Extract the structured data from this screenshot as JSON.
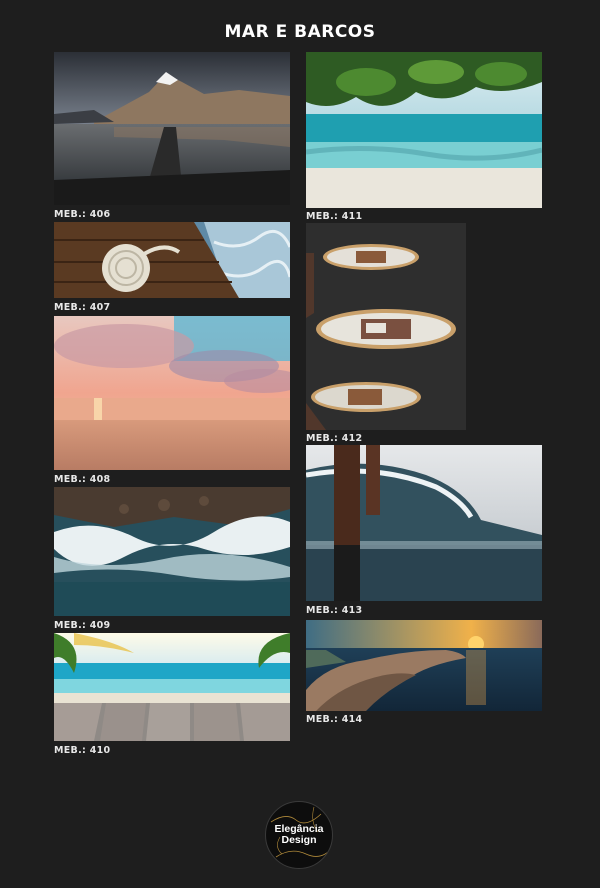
{
  "header": {
    "title": "MAR E BARCOS"
  },
  "items": [
    {
      "code": "MEB.: 406",
      "subject": "mountain lake with wooden pier"
    },
    {
      "code": "MEB.: 407",
      "subject": "coiled rope on dock by the sea"
    },
    {
      "code": "MEB.: 408",
      "subject": "pink sunset over the sea"
    },
    {
      "code": "MEB.: 409",
      "subject": "aerial view of waves on rocky shore"
    },
    {
      "code": "MEB.: 410",
      "subject": "tropical beach with palm leaves and wooden deck"
    },
    {
      "code": "MEB.: 411",
      "subject": "turquoise beach under tree branch"
    },
    {
      "code": "MEB.: 412",
      "subject": "three wooden boats seen from above"
    },
    {
      "code": "MEB.: 413",
      "subject": "wave breaking against pier post"
    },
    {
      "code": "MEB.: 414",
      "subject": "coastal cliff at sunset"
    }
  ],
  "logo": {
    "line1": "Elegância",
    "line2": "Design"
  },
  "colors": {
    "background": "#1e1e1e",
    "text": "#ffffff"
  }
}
